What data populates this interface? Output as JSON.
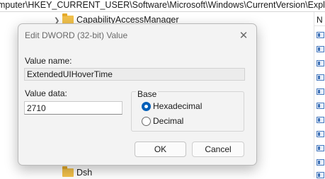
{
  "address_bar": {
    "path": "mputer\\HKEY_CURRENT_USER\\Software\\Microsoft\\Windows\\CurrentVersion\\Explorer\\Adv"
  },
  "tree": {
    "top_item": "CapabilityAccessManager",
    "bottom_item": "Dsh"
  },
  "list_header": "N",
  "dialog": {
    "title": "Edit DWORD (32-bit) Value",
    "close_glyph": "✕",
    "value_name_label": "Value name:",
    "value_name": "ExtendedUIHoverTime",
    "value_data_label": "Value data:",
    "value_data": "2710",
    "base_label": "Base",
    "base_options": [
      "Hexadecimal",
      "Decimal"
    ],
    "base_selected": "Hexadecimal",
    "ok_label": "OK",
    "cancel_label": "Cancel"
  },
  "colors": {
    "accent": "#005fb8",
    "folder": "#f2c14b",
    "dialog_bg": "#f3f3f3"
  }
}
